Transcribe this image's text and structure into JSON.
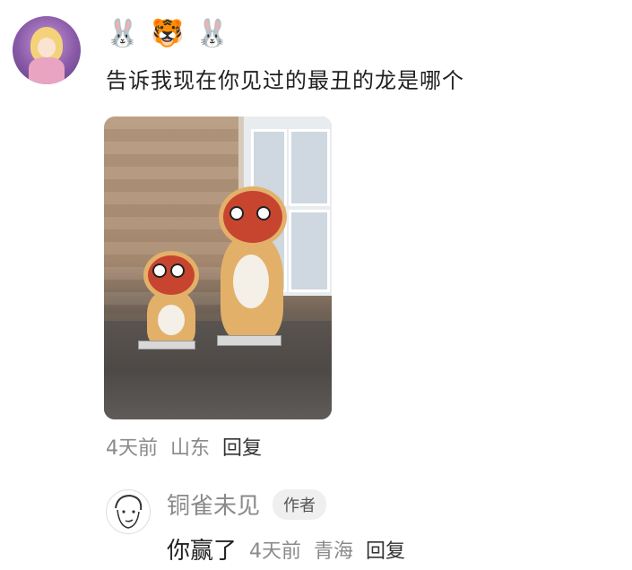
{
  "comment": {
    "author_emojis": [
      "🐰",
      "🐯",
      "🐰"
    ],
    "text": "告诉我现在你见过的最丑的龙是哪个",
    "time": "4天前",
    "location": "山东",
    "reply_label": "回复"
  },
  "reply": {
    "author_name": "铜雀未见",
    "author_badge": "作者",
    "text": "你赢了",
    "time": "4天前",
    "location": "青海",
    "reply_label": "回复"
  }
}
